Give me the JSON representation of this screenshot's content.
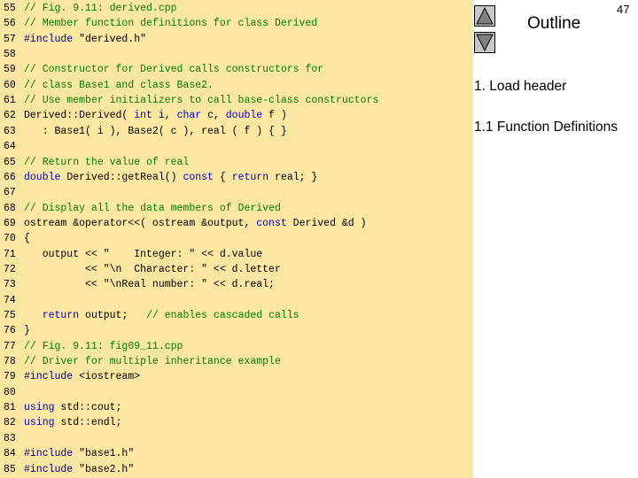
{
  "slide": {
    "number": "47",
    "outline_title": "Outline"
  },
  "outline": [
    "1. Load header",
    "1.1 Function Definitions"
  ],
  "nav": {
    "up_icon": "triangle-up-icon",
    "down_icon": "triangle-down-icon"
  },
  "colors": {
    "panel_bg": "#fbe7a1",
    "comment": "#008000",
    "keyword": "#0000cc"
  },
  "code_lines": [
    {
      "n": "55",
      "segs": [
        {
          "t": "// Fig. 9.11: derived.cpp",
          "c": "cm"
        }
      ]
    },
    {
      "n": "56",
      "segs": [
        {
          "t": "// Member function definitions for class Derived",
          "c": "cm"
        }
      ]
    },
    {
      "n": "57",
      "segs": [
        {
          "t": "#include",
          "c": "pp"
        },
        {
          "t": " \"derived.h\"",
          "c": ""
        }
      ]
    },
    {
      "n": "58",
      "segs": []
    },
    {
      "n": "59",
      "segs": [
        {
          "t": "// Constructor for Derived calls constructors for",
          "c": "cm"
        }
      ]
    },
    {
      "n": "60",
      "segs": [
        {
          "t": "// class Base1 and class Base2.",
          "c": "cm"
        }
      ]
    },
    {
      "n": "61",
      "segs": [
        {
          "t": "// Use member initializers to call base-class constructors",
          "c": "cm"
        }
      ]
    },
    {
      "n": "62",
      "segs": [
        {
          "t": "Derived::Derived( ",
          "c": ""
        },
        {
          "t": "int",
          "c": "kw"
        },
        {
          "t": " i, ",
          "c": ""
        },
        {
          "t": "char",
          "c": "kw"
        },
        {
          "t": " c, ",
          "c": ""
        },
        {
          "t": "double",
          "c": "kw"
        },
        {
          "t": " f )",
          "c": ""
        }
      ]
    },
    {
      "n": "63",
      "segs": [
        {
          "t": "   : Base1( i ), Base2( c ), real ( f ) { }",
          "c": ""
        }
      ]
    },
    {
      "n": "64",
      "segs": []
    },
    {
      "n": "65",
      "segs": [
        {
          "t": "// Return the value of real",
          "c": "cm"
        }
      ]
    },
    {
      "n": "66",
      "segs": [
        {
          "t": "double",
          "c": "kw"
        },
        {
          "t": " Derived::getReal() ",
          "c": ""
        },
        {
          "t": "const",
          "c": "kw"
        },
        {
          "t": " { ",
          "c": ""
        },
        {
          "t": "return",
          "c": "kw"
        },
        {
          "t": " real; }",
          "c": ""
        }
      ]
    },
    {
      "n": "67",
      "segs": []
    },
    {
      "n": "68",
      "segs": [
        {
          "t": "// Display all the data members of Derived",
          "c": "cm"
        }
      ]
    },
    {
      "n": "69",
      "segs": [
        {
          "t": "ostream &operator<<( ostream &output, ",
          "c": ""
        },
        {
          "t": "const",
          "c": "kw"
        },
        {
          "t": " Derived &d )",
          "c": ""
        }
      ]
    },
    {
      "n": "70",
      "segs": [
        {
          "t": "{",
          "c": ""
        }
      ]
    },
    {
      "n": "71",
      "segs": [
        {
          "t": "   output << \"    Integer: \" << d.value",
          "c": ""
        }
      ]
    },
    {
      "n": "72",
      "segs": [
        {
          "t": "          << \"\\n  Character: \" << d.letter",
          "c": ""
        }
      ]
    },
    {
      "n": "73",
      "segs": [
        {
          "t": "          << \"\\nReal number: \" << d.real;",
          "c": ""
        }
      ]
    },
    {
      "n": "74",
      "segs": []
    },
    {
      "n": "75",
      "segs": [
        {
          "t": "   ",
          "c": ""
        },
        {
          "t": "return",
          "c": "kw"
        },
        {
          "t": " output;   ",
          "c": ""
        },
        {
          "t": "// enables cascaded calls",
          "c": "cm"
        }
      ]
    },
    {
      "n": "76",
      "segs": [
        {
          "t": "}",
          "c": ""
        }
      ]
    },
    {
      "n": "77",
      "segs": [
        {
          "t": "// Fig. 9.11: fig09_11.cpp",
          "c": "cm"
        }
      ]
    },
    {
      "n": "78",
      "segs": [
        {
          "t": "// Driver for multiple inheritance example",
          "c": "cm"
        }
      ]
    },
    {
      "n": "79",
      "segs": [
        {
          "t": "#include",
          "c": "pp"
        },
        {
          "t": " <iostream>",
          "c": ""
        }
      ]
    },
    {
      "n": "80",
      "segs": []
    },
    {
      "n": "81",
      "segs": [
        {
          "t": "using",
          "c": "kw"
        },
        {
          "t": " std::cout;",
          "c": ""
        }
      ]
    },
    {
      "n": "82",
      "segs": [
        {
          "t": "using",
          "c": "kw"
        },
        {
          "t": " std::endl;",
          "c": ""
        }
      ]
    },
    {
      "n": "83",
      "segs": []
    },
    {
      "n": "84",
      "segs": [
        {
          "t": "#include",
          "c": "pp"
        },
        {
          "t": " \"base1.h\"",
          "c": ""
        }
      ]
    },
    {
      "n": "85",
      "segs": [
        {
          "t": "#include",
          "c": "pp"
        },
        {
          "t": " \"base2.h\"",
          "c": ""
        }
      ]
    }
  ]
}
